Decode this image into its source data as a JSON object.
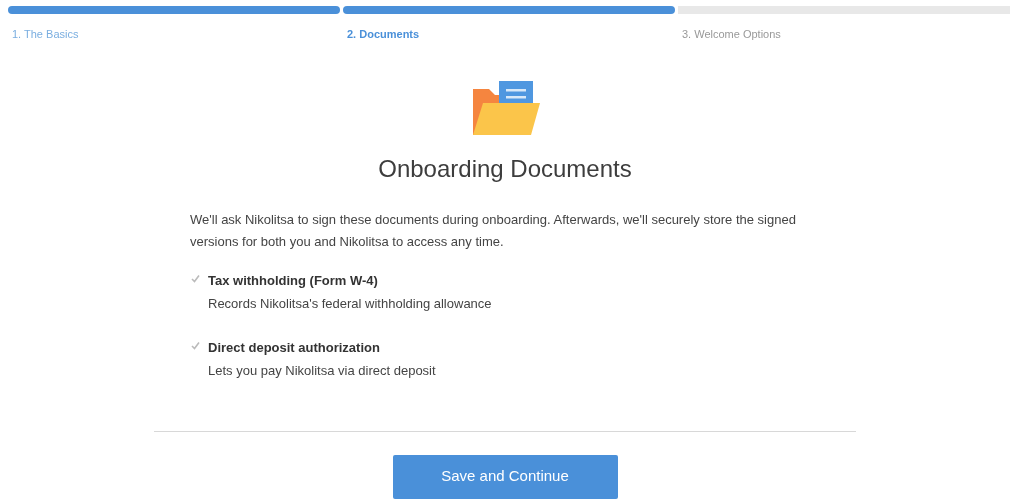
{
  "steps": [
    {
      "label": "1. The Basics",
      "selected": false,
      "completed": true
    },
    {
      "label": "2. Documents",
      "selected": true,
      "completed": true
    },
    {
      "label": "3. Welcome Options",
      "selected": false,
      "completed": false
    }
  ],
  "heading": "Onboarding Documents",
  "intro": "We'll ask Nikolitsa to sign these documents during onboarding. Afterwards, we'll securely store the signed versions for both you and Nikolitsa to access any time.",
  "documents": [
    {
      "title": "Tax withholding (Form W-4)",
      "description": "Records Nikolitsa's federal withholding allowance",
      "checked": true,
      "disabled": true
    },
    {
      "title": "Direct deposit authorization",
      "description": "Lets you pay Nikolitsa via direct deposit",
      "checked": true,
      "disabled": true
    }
  ],
  "button": "Save and Continue"
}
